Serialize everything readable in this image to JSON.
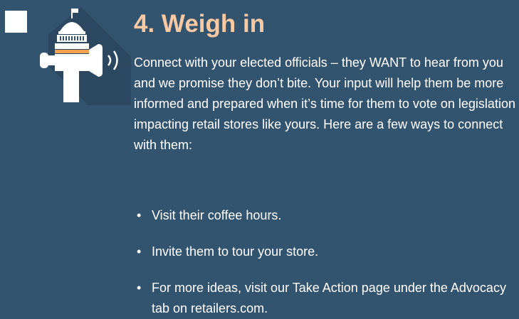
{
  "section": {
    "title": "4. Weigh in",
    "paragraph": "Connect with your elected officials – they WANT to hear from you and we promise they don’t bite. Your input will help them be more informed and prepared when it’s time for them to vote on legislation impacting retail stores like yours. Here are a few ways to connect with them:",
    "bullets": [
      "Visit their coffee hours.",
      "Invite them to tour your store.",
      "For more ideas, visit our Take Action page under the Advocacy tab on retailers.com."
    ],
    "bullet_glyph": "•"
  },
  "icon": {
    "name": "capitol-megaphone-icon"
  },
  "colors": {
    "background": "#33546f",
    "title": "#f9c9a3",
    "text": "#ffffff",
    "shadow": "#2b4860",
    "accent": "#f2a14e"
  }
}
